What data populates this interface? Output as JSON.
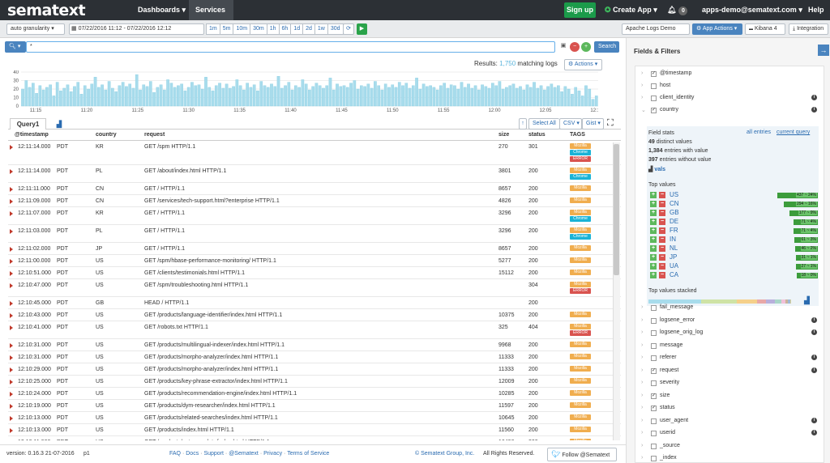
{
  "brand": {
    "logo": "sematext"
  },
  "nav": {
    "dashboards": "Dashboards",
    "services": "Services",
    "signup": "Sign up",
    "create_app": "Create App",
    "notif_count": "0",
    "account": "apps-demo@sematext.com",
    "help": "Help"
  },
  "toolbar": {
    "granularity": "auto granularity",
    "daterange": "07/22/2016 11:12 - 07/22/2016 12:12",
    "ranges": [
      "1m",
      "5m",
      "10m",
      "30m",
      "1h",
      "6h",
      "1d",
      "2d",
      "1w",
      "30d"
    ],
    "app_name": "Apache Logs Demo",
    "app_actions": "App Actions",
    "kibana": "Kibana 4",
    "integration": "Integration"
  },
  "search": {
    "query": "*",
    "button": "Search"
  },
  "results": {
    "prefix": "Results:",
    "count": "1,750",
    "suffix": "matching logs",
    "actions": "Actions"
  },
  "chart_data": {
    "type": "bar",
    "yticks": [
      "40",
      "30",
      "20",
      "10",
      "0"
    ],
    "ylim": [
      0,
      40
    ],
    "xticks": [
      "11:15",
      "11:20",
      "11:25",
      "11:30",
      "11:35",
      "11:40",
      "11:45",
      "11:50",
      "11:55",
      "12:00",
      "12:05",
      "12:10"
    ],
    "values": [
      20,
      30,
      22,
      27,
      15,
      24,
      19,
      22,
      25,
      12,
      28,
      18,
      21,
      25,
      17,
      23,
      28,
      14,
      24,
      20,
      26,
      34,
      22,
      25,
      19,
      29,
      21,
      17,
      24,
      28,
      23,
      26,
      21,
      37,
      19,
      25,
      23,
      29,
      16,
      22,
      25,
      19,
      31,
      27,
      22,
      24,
      26,
      18,
      22,
      28,
      24,
      25,
      20,
      34,
      22,
      18,
      24,
      27,
      21,
      26,
      21,
      23,
      31,
      24,
      19,
      27,
      22,
      25,
      18,
      29,
      24,
      22,
      26,
      23,
      35,
      21,
      24,
      28,
      19,
      24,
      22,
      31,
      26,
      19,
      23,
      27,
      24,
      21,
      24,
      33,
      19,
      26,
      23,
      24,
      22,
      27,
      30,
      20,
      24,
      23,
      26,
      21,
      29,
      24,
      19,
      26,
      22,
      25,
      22,
      28,
      24,
      27,
      21,
      24,
      33,
      20,
      26,
      23,
      24,
      22,
      19,
      24,
      27,
      21,
      25,
      24,
      20,
      28,
      22,
      26,
      21,
      24,
      19,
      25,
      23,
      21,
      27,
      24,
      29,
      20,
      22,
      24,
      26,
      21,
      23,
      19,
      25,
      22,
      28,
      21,
      24,
      19,
      23,
      26,
      22,
      24,
      17,
      23,
      20,
      14,
      22,
      18,
      12,
      24,
      20,
      8,
      12
    ]
  },
  "tabs": {
    "query": "Query1"
  },
  "table_tools": {
    "select_all": "Select All",
    "csv": "CSV",
    "gist": "Gist"
  },
  "columns": [
    "@timestamp",
    "country",
    "request",
    "size",
    "status",
    "TAGS"
  ],
  "rows": [
    {
      "ts": "12:11:14.000",
      "tz": "PDT",
      "country": "KR",
      "request": "GET /spm HTTP/1.1",
      "size": "270",
      "status": "301",
      "tags": [
        "Mozilla",
        "Chrome",
        "ERROR"
      ]
    },
    {
      "ts": "12:11:14.000",
      "tz": "PDT",
      "country": "PL",
      "request": "GET /about/index.html HTTP/1.1",
      "size": "3801",
      "status": "200",
      "tags": [
        "Mozilla",
        "Chrome"
      ]
    },
    {
      "ts": "12:11:11.000",
      "tz": "PDT",
      "country": "CN",
      "request": "GET / HTTP/1.1",
      "size": "8657",
      "status": "200",
      "tags": [
        "Mozilla"
      ]
    },
    {
      "ts": "12:11:09.000",
      "tz": "PDT",
      "country": "CN",
      "request": "GET /services/tech-support.html?enterprise HTTP/1.1",
      "size": "4826",
      "status": "200",
      "tags": [
        "Mozilla"
      ]
    },
    {
      "ts": "12:11:07.000",
      "tz": "PDT",
      "country": "KR",
      "request": "GET / HTTP/1.1",
      "size": "3296",
      "status": "200",
      "tags": [
        "Mozilla",
        "Chrome"
      ]
    },
    {
      "ts": "12:11:03.000",
      "tz": "PDT",
      "country": "PL",
      "request": "GET / HTTP/1.1",
      "size": "3296",
      "status": "200",
      "tags": [
        "Mozilla",
        "Chrome"
      ]
    },
    {
      "ts": "12:11:02.000",
      "tz": "PDT",
      "country": "JP",
      "request": "GET / HTTP/1.1",
      "size": "8657",
      "status": "200",
      "tags": [
        "Mozilla"
      ]
    },
    {
      "ts": "12:11:00.000",
      "tz": "PDT",
      "country": "US",
      "request": "GET /spm/hbase-performance-monitoring/ HTTP/1.1",
      "size": "5277",
      "status": "200",
      "tags": [
        "Mozilla"
      ]
    },
    {
      "ts": "12:10:51.000",
      "tz": "PDT",
      "country": "US",
      "request": "GET /clients/testimonials.html HTTP/1.1",
      "size": "15112",
      "status": "200",
      "tags": [
        "Mozilla"
      ]
    },
    {
      "ts": "12:10:47.000",
      "tz": "PDT",
      "country": "US",
      "request": "GET /spm/troubleshooting.html HTTP/1.1",
      "size": "",
      "status": "304",
      "tags": [
        "Mozilla",
        "ERROR"
      ]
    },
    {
      "ts": "12:10:45.000",
      "tz": "PDT",
      "country": "GB",
      "request": "HEAD / HTTP/1.1",
      "size": "",
      "status": "200",
      "tags": []
    },
    {
      "ts": "12:10:43.000",
      "tz": "PDT",
      "country": "US",
      "request": "GET /products/language-identifier/index.html HTTP/1.1",
      "size": "10375",
      "status": "200",
      "tags": [
        "Mozilla"
      ]
    },
    {
      "ts": "12:10:41.000",
      "tz": "PDT",
      "country": "US",
      "request": "GET /robots.txt HTTP/1.1",
      "size": "325",
      "status": "404",
      "tags": [
        "Mozilla",
        "ERROR"
      ]
    },
    {
      "ts": "12:10:31.000",
      "tz": "PDT",
      "country": "US",
      "request": "GET /products/multilingual-indexer/index.html HTTP/1.1",
      "size": "9968",
      "status": "200",
      "tags": [
        "Mozilla"
      ]
    },
    {
      "ts": "12:10:31.000",
      "tz": "PDT",
      "country": "US",
      "request": "GET /products/morpho-analyzer/index.html HTTP/1.1",
      "size": "11333",
      "status": "200",
      "tags": [
        "Mozilla"
      ]
    },
    {
      "ts": "12:10:29.000",
      "tz": "PDT",
      "country": "US",
      "request": "GET /products/morpho-analyzer/index.html HTTP/1.1",
      "size": "11333",
      "status": "200",
      "tags": [
        "Mozilla"
      ]
    },
    {
      "ts": "12:10:25.000",
      "tz": "PDT",
      "country": "US",
      "request": "GET /products/key-phrase-extractor/index.html HTTP/1.1",
      "size": "12009",
      "status": "200",
      "tags": [
        "Mozilla"
      ]
    },
    {
      "ts": "12:10:24.000",
      "tz": "PDT",
      "country": "US",
      "request": "GET /products/recommendation-engine/index.html HTTP/1.1",
      "size": "10285",
      "status": "200",
      "tags": [
        "Mozilla"
      ]
    },
    {
      "ts": "12:10:19.000",
      "tz": "PDT",
      "country": "US",
      "request": "GET /products/dym-researcher/index.html HTTP/1.1",
      "size": "11597",
      "status": "200",
      "tags": [
        "Mozilla"
      ]
    },
    {
      "ts": "12:10:13.000",
      "tz": "PDT",
      "country": "US",
      "request": "GET /products/related-searches/index.html HTTP/1.1",
      "size": "10645",
      "status": "200",
      "tags": [
        "Mozilla"
      ]
    },
    {
      "ts": "12:10:13.000",
      "tz": "PDT",
      "country": "US",
      "request": "GET /products/index.html HTTP/1.1",
      "size": "11560",
      "status": "200",
      "tags": [
        "Mozilla"
      ]
    },
    {
      "ts": "12:10:11.000",
      "tz": "PDT",
      "country": "US",
      "request": "GET /products/autocomplete/index.html HTTP/1.1",
      "size": "16498",
      "status": "200",
      "tags": [
        "Mozilla"
      ]
    }
  ],
  "footer": {
    "version": "version: 0.16.3 21-07-2016",
    "page": "p1",
    "links": [
      "FAQ",
      "Docs",
      "Support",
      "@Sematext",
      "Privacy",
      "Terms of Service"
    ],
    "copyright": "© Sematext Group, Inc.",
    "rights": "All Rights Reserved.",
    "follow": "Follow @Sematext"
  },
  "panel": {
    "title": "Fields & Filters",
    "fields_top": [
      {
        "name": "@timestamp",
        "checked": true,
        "info": false
      },
      {
        "name": "host",
        "checked": false,
        "info": false
      },
      {
        "name": "client_identity",
        "checked": false,
        "info": true
      },
      {
        "name": "country",
        "checked": true,
        "info": true
      }
    ],
    "stats": {
      "label": "Field stats",
      "all_entries": "all entries",
      "current_query": "current query",
      "distinct": "49",
      "distinct_label": "distinct values",
      "with_value": "1,384",
      "with_value_label": "entries with value",
      "without_value": "397",
      "without_value_label": "entries without value",
      "vals": "vals",
      "top_values_label": "Top values",
      "top_values": [
        {
          "v": "US",
          "label": "437 ~ 24%",
          "pct": 24
        },
        {
          "v": "CN",
          "label": "294 ~ 16%",
          "pct": 16
        },
        {
          "v": "GB",
          "label": "177 ~ 9%",
          "pct": 9
        },
        {
          "v": "DE",
          "label": "71 ~ 4%",
          "pct": 4
        },
        {
          "v": "FR",
          "label": "71 ~ 4%",
          "pct": 4
        },
        {
          "v": "IN",
          "label": "61 ~ 3%",
          "pct": 3
        },
        {
          "v": "NL",
          "label": "46 ~ 2%",
          "pct": 2
        },
        {
          "v": "JP",
          "label": "31 ~ 1%",
          "pct": 1
        },
        {
          "v": "UA",
          "label": "27 ~ 1%",
          "pct": 1
        },
        {
          "v": "CA",
          "label": "18 ~ 0%",
          "pct": 0
        }
      ],
      "stacked_label": "Top values stacked"
    },
    "fields_bottom": [
      {
        "name": "fail_message",
        "checked": false,
        "info": false
      },
      {
        "name": "logsene_error",
        "checked": false,
        "info": true
      },
      {
        "name": "logsene_orig_log",
        "checked": false,
        "info": true
      },
      {
        "name": "message",
        "checked": false,
        "info": false
      },
      {
        "name": "referer",
        "checked": false,
        "info": true
      },
      {
        "name": "request",
        "checked": true,
        "info": true
      },
      {
        "name": "severity",
        "checked": false,
        "info": false
      },
      {
        "name": "size",
        "checked": true,
        "info": false
      },
      {
        "name": "status",
        "checked": true,
        "info": false
      },
      {
        "name": "user_agent",
        "checked": false,
        "info": true
      },
      {
        "name": "userid",
        "checked": false,
        "info": true
      },
      {
        "name": "_source",
        "checked": false,
        "info": false
      },
      {
        "name": "_index",
        "checked": false,
        "info": false
      }
    ]
  },
  "colors": {
    "nav_bg": "#2c3035",
    "accent": "#2a6bb0",
    "bar": "#a8dcec",
    "mozilla": "#f0ad4e",
    "chrome": "#1ab3d6",
    "error": "#d9534f",
    "signup": "#1b9b4a"
  }
}
